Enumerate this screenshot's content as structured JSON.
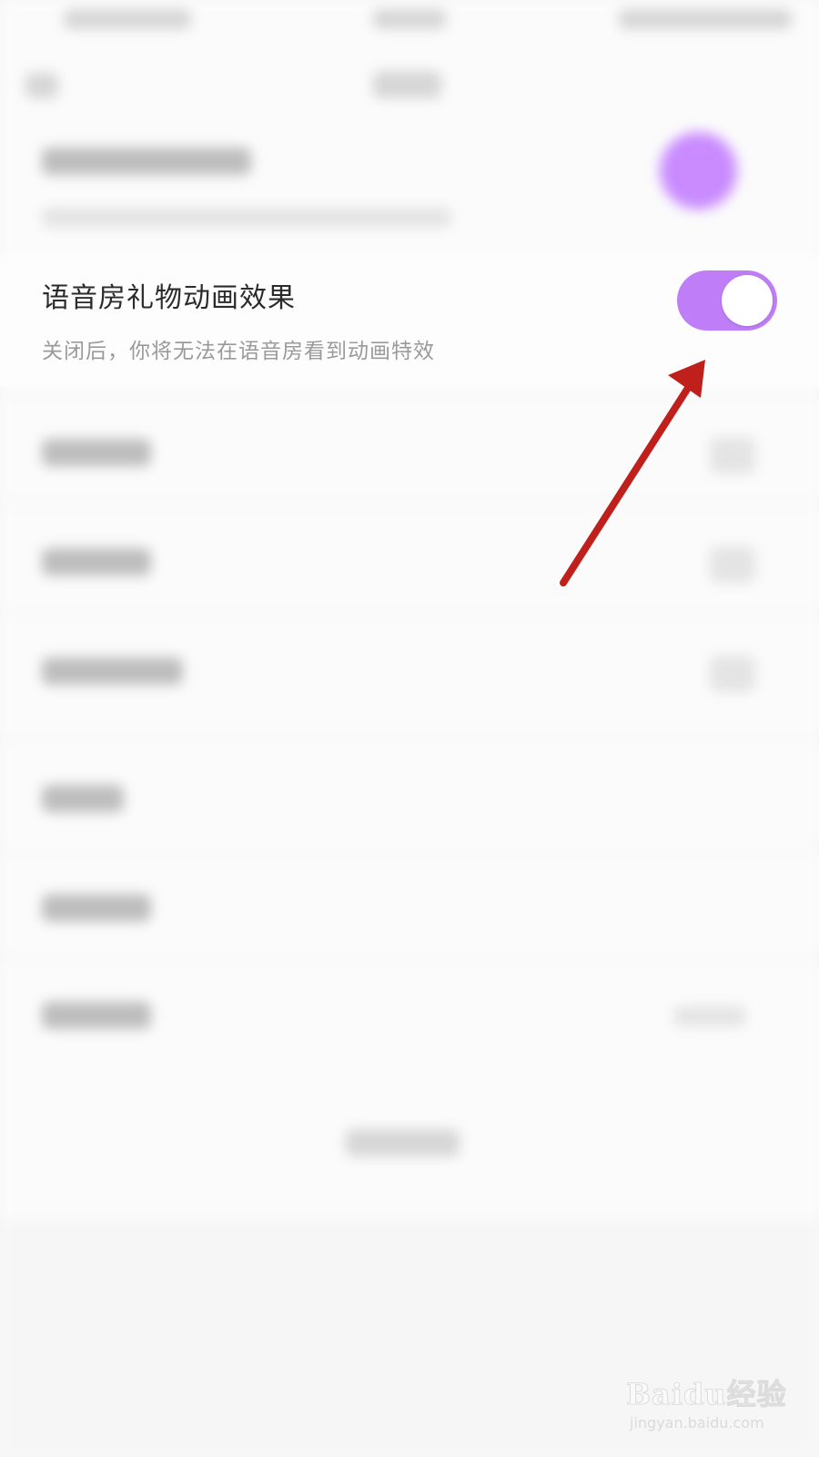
{
  "setting": {
    "title": "语音房礼物动画效果",
    "description": "关闭后，你将无法在语音房看到动画特效",
    "toggle_on": true
  },
  "colors": {
    "toggle_on": "#bf7ef7",
    "arrow": "#c0201c",
    "background": "#fbfbfb"
  },
  "watermark": {
    "brand": "Baidu经验",
    "url": "jingyan.baidu.com"
  }
}
